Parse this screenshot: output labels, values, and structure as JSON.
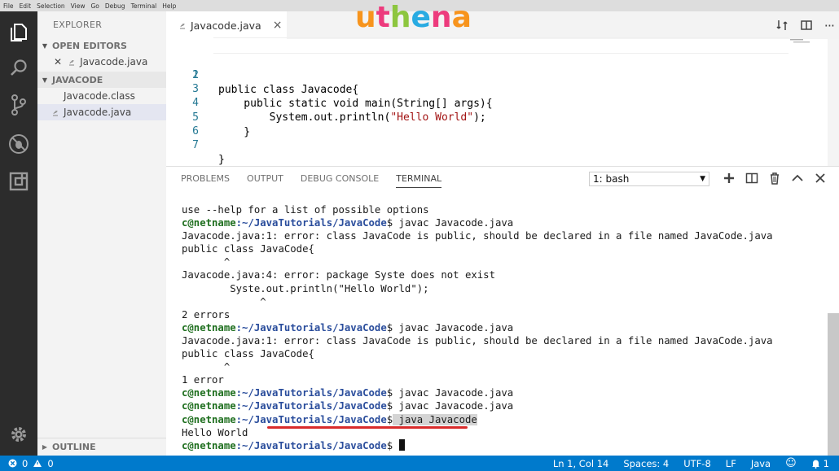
{
  "menubar": [
    "File",
    "Edit",
    "Selection",
    "View",
    "Go",
    "Debug",
    "Terminal",
    "Help"
  ],
  "sidebar": {
    "title": "EXPLORER",
    "open_editors_label": "OPEN EDITORS",
    "open_editor_file": "Javacode.java",
    "folder_label": "JAVACODE",
    "files": [
      "Javacode.class",
      "Javacode.java"
    ],
    "outline_label": "OUTLINE"
  },
  "tab": {
    "label": "Javacode.java"
  },
  "logo": {
    "parts": [
      "u",
      "t",
      "h",
      "e",
      "n",
      "a"
    ],
    "colors": [
      "#f7941d",
      "#ed3b7d",
      "#8dc63f",
      "#29abe2",
      "#ed3b7d",
      "#f7941d"
    ]
  },
  "editor": {
    "lines": [
      {
        "num": "1",
        "code": "public class Javacode{"
      },
      {
        "num": "2",
        "code": ""
      },
      {
        "num": "3",
        "code": "    public static void main(String[] args){"
      },
      {
        "num": "4",
        "code": "        System.out.println(",
        "str": "\"Hello World\"",
        "tail": ");"
      },
      {
        "num": "5",
        "code": "    }"
      },
      {
        "num": "6",
        "code": ""
      },
      {
        "num": "7",
        "code": "}"
      }
    ]
  },
  "panel": {
    "tabs": [
      "PROBLEMS",
      "OUTPUT",
      "DEBUG CONSOLE",
      "TERMINAL"
    ],
    "active_tab": "TERMINAL",
    "shell_select": "1: bash"
  },
  "terminal": {
    "prompt_user": "c@netname",
    "prompt_path": ":~/JavaTutorials/JavaCode",
    "lines": [
      {
        "text": "use --help for a list of possible options"
      },
      {
        "prompt": true,
        "cmd": " javac Javacode.java"
      },
      {
        "text": "Javacode.java:1: error: class JavaCode is public, should be declared in a file named JavaCode.java"
      },
      {
        "text": "public class JavaCode{"
      },
      {
        "text": "       ^"
      },
      {
        "text": "Javacode.java:4: error: package Syste does not exist"
      },
      {
        "text": "        Syste.out.println(\"Hello World\");"
      },
      {
        "text": "             ^"
      },
      {
        "text": "2 errors"
      },
      {
        "prompt": true,
        "cmd": " javac Javacode.java"
      },
      {
        "text": "Javacode.java:1: error: class JavaCode is public, should be declared in a file named JavaCode.java"
      },
      {
        "text": "public class JavaCode{"
      },
      {
        "text": "       ^"
      },
      {
        "text": "1 error"
      },
      {
        "prompt": true,
        "cmd": " javac Javacode.java"
      },
      {
        "prompt": true,
        "cmd": " javac Javacode.java"
      },
      {
        "prompt": true,
        "cmd": " java Javacode",
        "highlight": true
      },
      {
        "text": "Hello World"
      },
      {
        "prompt": true,
        "cmd": " ",
        "cursor": true
      }
    ]
  },
  "status": {
    "errors": "0",
    "warnings": "0",
    "position": "Ln 1, Col 14",
    "spaces": "Spaces: 4",
    "encoding": "UTF-8",
    "eol": "LF",
    "language": "Java",
    "notifications": "1"
  }
}
